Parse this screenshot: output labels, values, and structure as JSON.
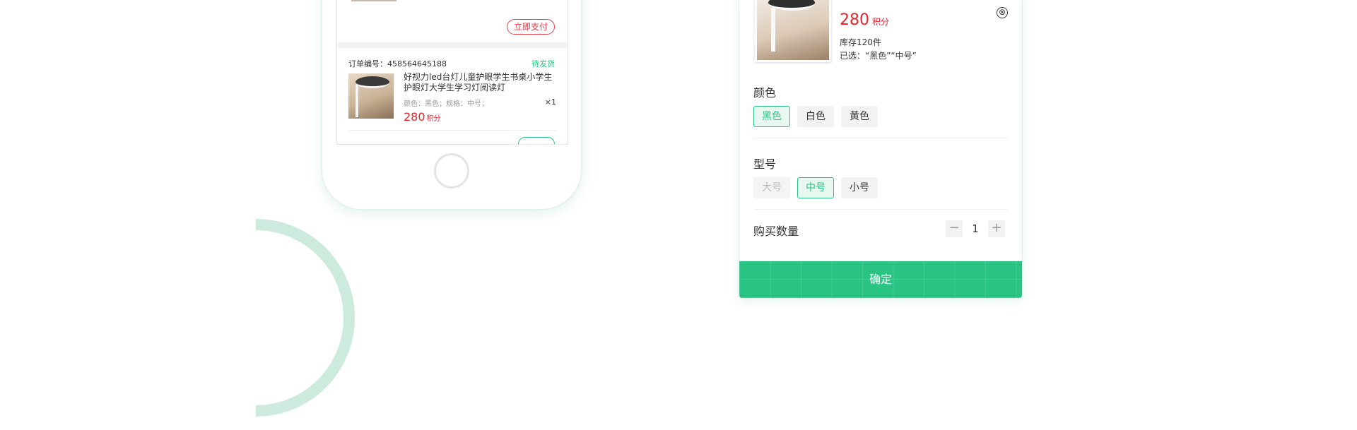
{
  "phone": {
    "pay_button": "立即支付",
    "order": {
      "number": "订单编号：458564645188",
      "status": "待发货",
      "title": "好视力led台灯儿童护眼学生书桌小学生护眼灯大学生学习灯阅读灯",
      "spec": "颜色：黑色；规格：中号；",
      "quantity": "×1",
      "price": "280",
      "unit": "积分"
    }
  },
  "sku_panel": {
    "price": "280",
    "unit": "积分",
    "stock": "库存120件",
    "selected": "已选：“黑色”“中号”",
    "close_icon": "⊗",
    "color_section": {
      "title": "颜色",
      "options": [
        {
          "label": "黑色",
          "state": "active"
        },
        {
          "label": "白色",
          "state": "normal"
        },
        {
          "label": "黄色",
          "state": "normal"
        }
      ]
    },
    "size_section": {
      "title": "型号",
      "options": [
        {
          "label": "大号",
          "state": "disabled"
        },
        {
          "label": "中号",
          "state": "active"
        },
        {
          "label": "小号",
          "state": "normal"
        }
      ]
    },
    "quantity_label": "购买数量",
    "quantity": "1",
    "minus_icon": "−",
    "plus_icon": "+",
    "confirm_label": "确定"
  },
  "colors": {
    "accent": "#29c383",
    "price": "#e8232b",
    "ring": "#cdebdc"
  }
}
